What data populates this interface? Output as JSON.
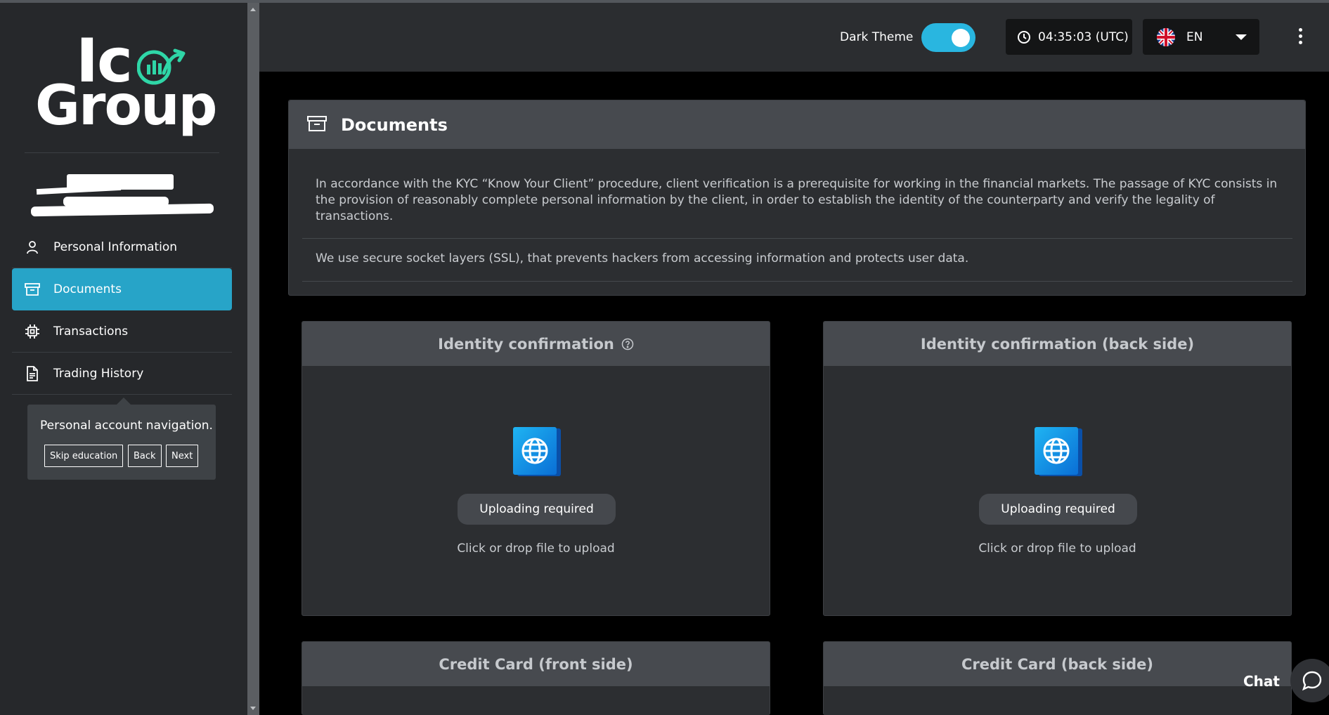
{
  "brand": {
    "logo_line1": "Ic",
    "logo_line2": "Group"
  },
  "sidebar": {
    "items": [
      {
        "label": "Personal Information",
        "icon": "user-icon"
      },
      {
        "label": "Documents",
        "icon": "archive-icon",
        "active": true
      },
      {
        "label": "Transactions",
        "icon": "chip-icon"
      },
      {
        "label": "Trading History",
        "icon": "document-icon"
      }
    ]
  },
  "tour": {
    "text": "Personal account navigation.",
    "skip_label": "Skip education",
    "back_label": "Back",
    "next_label": "Next"
  },
  "header": {
    "theme_label": "Dark Theme",
    "theme_on": true,
    "clock": "04:35:03 (UTC)",
    "language": "EN"
  },
  "documents": {
    "title": "Documents",
    "paragraph1": "In accordance with the KYC “Know Your Client” procedure, client verification is a prerequisite for working in the financial markets. The passage of KYC consists in the provision of reasonably complete personal information by the client, in order to establish the identity of the counterparty and verify the legality of transactions.",
    "paragraph2": "We use secure socket layers (SSL), that prevents hackers from accessing information and protects user data."
  },
  "cards": [
    {
      "title": "Identity confirmation",
      "status": "Uploading required",
      "hint": "Click or drop file to upload"
    },
    {
      "title": "Identity confirmation (back side)",
      "status": "Uploading required",
      "hint": "Click or drop file to upload"
    },
    {
      "title": "Credit Card (front side)"
    },
    {
      "title": "Credit Card (back side)"
    }
  ],
  "chat": {
    "label": "Chat"
  },
  "colors": {
    "accent": "#27a4c8",
    "toggle": "#29b6e0",
    "logo_accent": "#2fd6a7"
  }
}
